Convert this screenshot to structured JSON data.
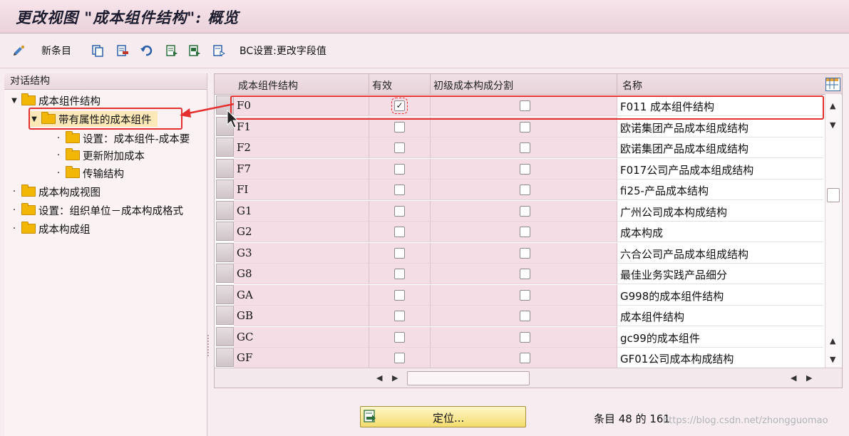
{
  "window": {
    "title": "更改视图 \"成本组件结构\": 概览"
  },
  "toolbar": {
    "new_entries_label": "新条目",
    "bc_set_label": "BC设置:更改字段值",
    "icons": [
      "display-change-icon",
      "copy-icon",
      "delete-icon",
      "undo-icon",
      "select-all-icon",
      "select-block-icon",
      "deselect-all-icon"
    ]
  },
  "tree": {
    "header": "对话结构",
    "nodes": [
      {
        "label": "成本组件结构",
        "state": "open"
      },
      {
        "label": "带有属性的成本组件",
        "state": "open",
        "selected": true
      },
      {
        "label": "设置：成本组件-成本要"
      },
      {
        "label": "更新附加成本"
      },
      {
        "label": "传输结构"
      },
      {
        "label": "成本构成视图"
      },
      {
        "label": "设置：组织单位－成本构成格式"
      },
      {
        "label": "成本构成组"
      }
    ]
  },
  "table": {
    "columns": [
      "成本组件结构",
      "有效",
      "初级成本构成分割",
      "名称"
    ],
    "rows": [
      {
        "code": "F0",
        "active": true,
        "primary": false,
        "name": "F011 成本组件结构"
      },
      {
        "code": "F1",
        "active": false,
        "primary": false,
        "name": "欧诺集团产品成本组成结构"
      },
      {
        "code": "F2",
        "active": false,
        "primary": false,
        "name": "欧诺集团产品成本组成结构"
      },
      {
        "code": "F7",
        "active": false,
        "primary": false,
        "name": "F017公司产品成本组成结构"
      },
      {
        "code": "FI",
        "active": false,
        "primary": false,
        "name": "fi25-产品成本结构"
      },
      {
        "code": "G1",
        "active": false,
        "primary": false,
        "name": "广州公司成本构成结构"
      },
      {
        "code": "G2",
        "active": false,
        "primary": false,
        "name": "成本构成"
      },
      {
        "code": "G3",
        "active": false,
        "primary": false,
        "name": "六合公司产品成本组成结构"
      },
      {
        "code": "G8",
        "active": false,
        "primary": false,
        "name": "最佳业务实践产品细分"
      },
      {
        "code": "GA",
        "active": false,
        "primary": false,
        "name": "G998的成本组件结构"
      },
      {
        "code": "GB",
        "active": false,
        "primary": false,
        "name": "成本组件结构"
      },
      {
        "code": "GC",
        "active": false,
        "primary": false,
        "name": "gc99的成本组件"
      },
      {
        "code": "GF",
        "active": false,
        "primary": false,
        "name": "GF01公司成本构成结构"
      }
    ]
  },
  "footer": {
    "locate_label": "定位...",
    "entry_status": "条目 48 的 161",
    "watermark": "https://blog.csdn.net/zhongguomao"
  },
  "colors": {
    "highlight": "#e53030",
    "title_bg": "#ead2da",
    "locate_button": "#f4dc6e"
  }
}
